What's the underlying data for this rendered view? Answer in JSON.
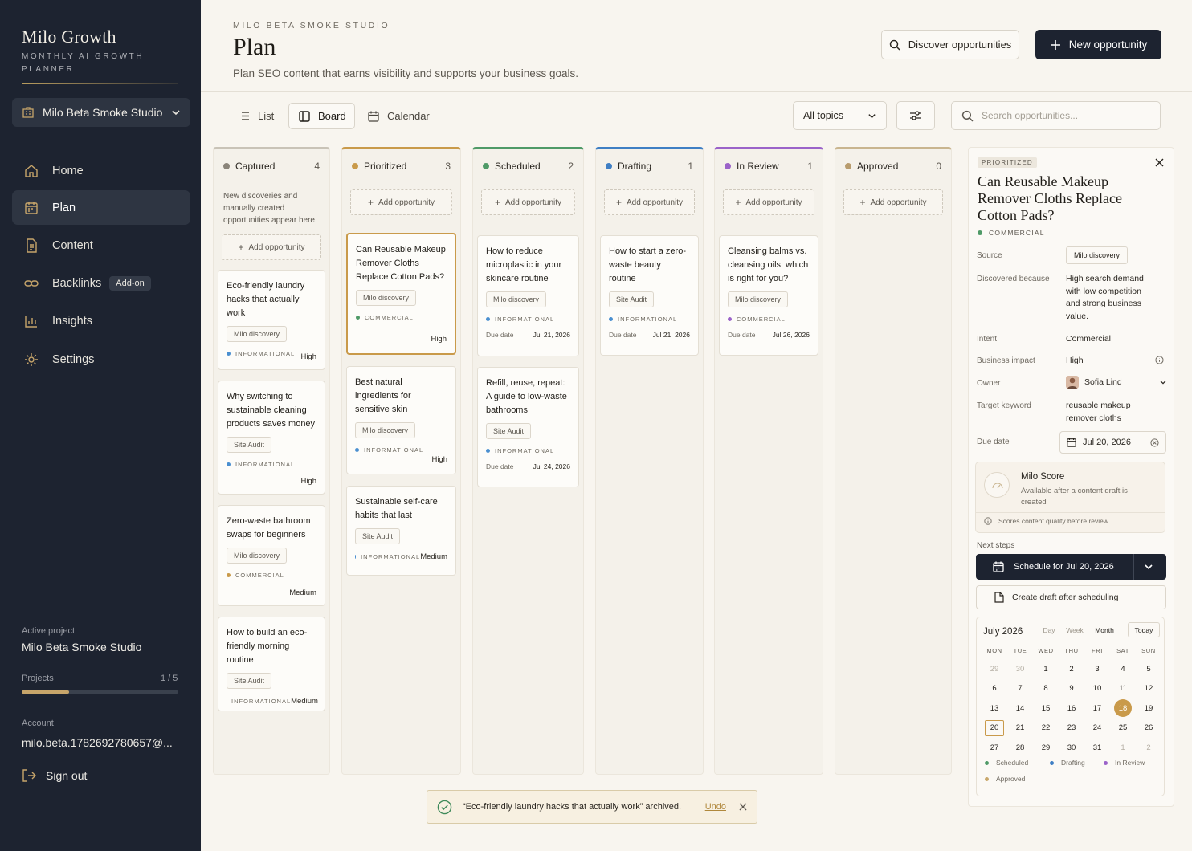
{
  "sidebar": {
    "brand_title": "Milo Growth",
    "brand_subtitle": "MONTHLY AI GROWTH PLANNER",
    "studio_select": "Milo Beta Smoke Studio",
    "nav": [
      {
        "label": "Home",
        "icon": "home-icon"
      },
      {
        "label": "Plan",
        "icon": "calendar-icon",
        "active": true
      },
      {
        "label": "Content",
        "icon": "document-icon"
      },
      {
        "label": "Backlinks",
        "icon": "link-icon",
        "badge": "Add-on"
      },
      {
        "label": "Insights",
        "icon": "bar-chart-icon"
      },
      {
        "label": "Settings",
        "icon": "gear-icon"
      }
    ],
    "active_project_label": "Active project",
    "active_project": "Milo Beta Smoke Studio",
    "projects_label": "Projects",
    "projects_count": "1 / 5",
    "projects_fraction": 0.3,
    "account_label": "Account",
    "account": "milo.beta.1782692780657@...",
    "signout": "Sign out"
  },
  "header": {
    "eyebrow": "MILO BETA SMOKE STUDIO",
    "title": "Plan",
    "subtitle": "Plan SEO content that earns visibility and supports your business goals.",
    "discover_button": "Discover opportunities",
    "new_button": "New opportunity"
  },
  "toolbar": {
    "views": [
      "List",
      "Board",
      "Calendar"
    ],
    "active_view": "Board",
    "topic_select": "All topics",
    "search_placeholder": "Search opportunities..."
  },
  "colors": {
    "captured": "#8a847a",
    "prioritized": "#c99a4a",
    "scheduled": "#4f9a67",
    "drafting": "#3f7fc4",
    "in_review": "#9b63c9",
    "approved": "#b89c6e",
    "informational": "#4a8fd0",
    "commercial": "#c99a4a",
    "commercial_green": "#4f9a67",
    "commercial_purple": "#9b63c9"
  },
  "board": {
    "add_label": "Add opportunity",
    "captured": {
      "title": "Captured",
      "count": "4",
      "description": "New discoveries and manually created opportunities appear here.",
      "cards": [
        {
          "title": "Eco-friendly laundry hacks that actually work",
          "source": "Milo discovery",
          "intent": "INFORMATIONAL",
          "impact": "High"
        },
        {
          "title": "Why switching to sustainable cleaning products saves money",
          "source": "Site Audit",
          "intent": "INFORMATIONAL",
          "impact": "High"
        },
        {
          "title": "Zero-waste bathroom swaps for beginners",
          "source": "Milo discovery",
          "intent": "COMMERCIAL",
          "impact": "Medium"
        },
        {
          "title": "How to build an eco-friendly morning routine",
          "source": "Site Audit",
          "intent": "INFORMATIONAL",
          "impact": "Medium"
        }
      ]
    },
    "prioritized": {
      "title": "Prioritized",
      "count": "3",
      "cards": [
        {
          "title": "Can Reusable Makeup Remover Cloths Replace Cotton Pads?",
          "source": "Milo discovery",
          "intent": "COMMERCIAL",
          "impact": "High"
        },
        {
          "title": "Best natural ingredients for sensitive skin",
          "source": "Milo discovery",
          "intent": "INFORMATIONAL",
          "impact": "High"
        },
        {
          "title": "Sustainable self-care habits that last",
          "source": "Site Audit",
          "intent": "INFORMATIONAL",
          "impact": "Medium"
        }
      ]
    },
    "scheduled": {
      "title": "Scheduled",
      "count": "2",
      "cards": [
        {
          "title": "How to reduce microplastic in your skincare routine",
          "source": "Milo discovery",
          "intent": "INFORMATIONAL",
          "due_label": "Due date",
          "due": "Jul 21, 2026"
        },
        {
          "title": "Refill, reuse, repeat: A guide to low-waste bathrooms",
          "source": "Site Audit",
          "intent": "INFORMATIONAL",
          "due_label": "Due date",
          "due": "Jul 24, 2026"
        }
      ]
    },
    "drafting": {
      "title": "Drafting",
      "count": "1",
      "cards": [
        {
          "title": "How to start a zero-waste beauty routine",
          "source": "Site Audit",
          "intent": "INFORMATIONAL",
          "due_label": "Due date",
          "due": "Jul 21, 2026"
        }
      ]
    },
    "in_review": {
      "title": "In Review",
      "count": "1",
      "cards": [
        {
          "title": "Cleansing balms vs. cleansing oils: which is right for you?",
          "source": "Milo discovery",
          "intent": "COMMERCIAL",
          "due_label": "Due date",
          "due": "Jul 26, 2026"
        }
      ]
    },
    "approved": {
      "title": "Approved",
      "count": "0"
    }
  },
  "detail": {
    "status": "PRIORITIZED",
    "title": "Can Reusable Makeup Remover Cloths Replace Cotton Pads?",
    "intent_tag": "COMMERCIAL",
    "source_label": "Source",
    "source": "Milo discovery",
    "discovered_label": "Discovered because",
    "discovered": "High search demand with low competition and strong business value.",
    "intent_label": "Intent",
    "intent": "Commercial",
    "impact_label": "Business impact",
    "impact": "High",
    "owner_label": "Owner",
    "owner": "Sofia Lind",
    "keyword_label": "Target keyword",
    "keyword": "reusable makeup remover cloths",
    "due_label": "Due date",
    "due": "Jul 20, 2026",
    "score_title": "Milo Score",
    "score_desc": "Available after a content draft is created",
    "score_note": "Scores content quality before review.",
    "next_steps_label": "Next steps",
    "schedule_button": "Schedule for Jul 20, 2026",
    "draft_button": "Create draft after scheduling"
  },
  "calendar": {
    "month": "July 2026",
    "tabs": [
      "Day",
      "Week",
      "Month"
    ],
    "today_button": "Today",
    "dow": [
      "MON",
      "TUE",
      "WED",
      "THU",
      "FRI",
      "SAT",
      "SUN"
    ],
    "weeks": [
      [
        "29",
        "30",
        "1",
        "2",
        "3",
        "4",
        "5"
      ],
      [
        "6",
        "7",
        "8",
        "9",
        "10",
        "11",
        "12"
      ],
      [
        "13",
        "14",
        "15",
        "16",
        "17",
        "18",
        "19"
      ],
      [
        "20",
        "21",
        "22",
        "23",
        "24",
        "25",
        "26"
      ],
      [
        "27",
        "28",
        "29",
        "30",
        "31",
        "1",
        "2"
      ]
    ],
    "legend": [
      "Scheduled",
      "Drafting",
      "In Review",
      "Approved"
    ]
  },
  "toast": {
    "message": "“Eco-friendly laundry hacks that actually work” archived.",
    "undo": "Undo"
  }
}
